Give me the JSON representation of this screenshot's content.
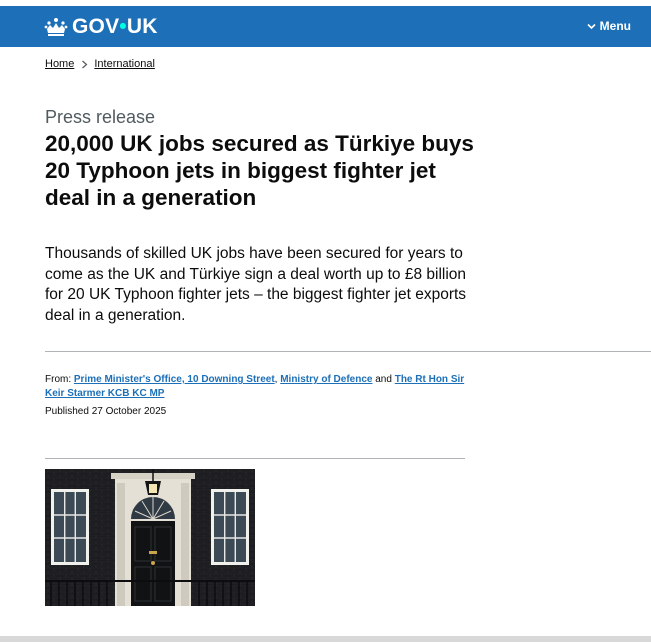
{
  "header": {
    "logo_text_left": "GOV",
    "logo_dot": "•",
    "logo_text_right": "UK",
    "menu_label": "Menu",
    "brand_color": "#1d70b8"
  },
  "breadcrumb": {
    "items": [
      "Home",
      "International"
    ]
  },
  "article": {
    "caption": "Press release",
    "title": "20,000 UK jobs secured as Türkiye buys 20 Typhoon jets in biggest fighter jet deal in a generation",
    "lede": "Thousands of skilled UK jobs have been secured for years to come as the UK and Türkiye sign a deal worth up to £8 billion for 20 UK Typhoon fighter jets – the biggest fighter jet exports deal in a generation."
  },
  "metadata": {
    "from_label": "From:",
    "orgs": [
      "Prime Minister's Office, 10 Downing Street",
      "Ministry of Defence",
      "The Rt Hon Sir Keir Starmer KCB KC MP"
    ],
    "separator_comma": ",",
    "separator_and": "and",
    "published_label": "Published",
    "published_date": "27 October 2025"
  },
  "icons": {
    "logo": "crown-icon",
    "menu": "chevron-down-icon",
    "breadcrumb_separator": "chevron-right-icon"
  }
}
